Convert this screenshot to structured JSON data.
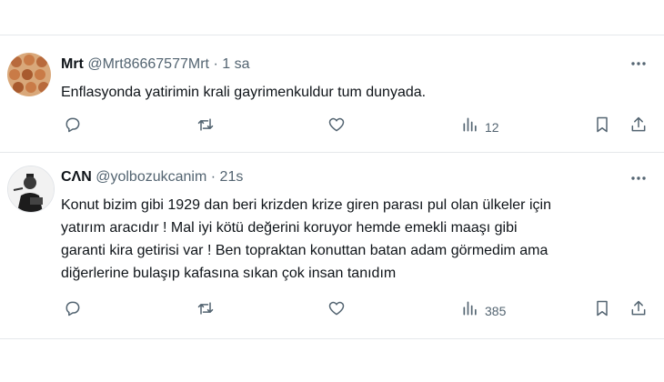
{
  "tweets": [
    {
      "display_name": "Mrt",
      "handle": "@Mrt86667577Mrt",
      "separator": "·",
      "time": "1 sa",
      "lines": [
        "Enflasyonda yatirimin krali gayrimenkuldur tum dunyada."
      ],
      "views": "12"
    },
    {
      "display_name": "CΛN",
      "handle": "@yolbozukcanim",
      "separator": "·",
      "time": "21s",
      "lines": [
        "Konut bizim gibi 1929 dan beri krizden krize giren parası pul olan ülkeler için",
        "yatırım aracıdır ! Mal iyi kötü değerini koruyor hemde emekli maaşı gibi",
        "garanti kira getirisi var ! Ben topraktan konuttan batan adam görmedim ama",
        "diğerlerine bulaşıp kafasına sıkan çok insan tanıdım"
      ],
      "views": "385"
    }
  ],
  "icons": {
    "reply": "reply-icon",
    "retweet": "retweet-icon",
    "like": "heart-icon",
    "views": "views-icon",
    "bookmark": "bookmark-icon",
    "share": "share-icon",
    "more": "more-icon"
  },
  "colors": {
    "text_primary": "#0f1419",
    "text_secondary": "#536471",
    "divider": "#e5e8eb"
  }
}
